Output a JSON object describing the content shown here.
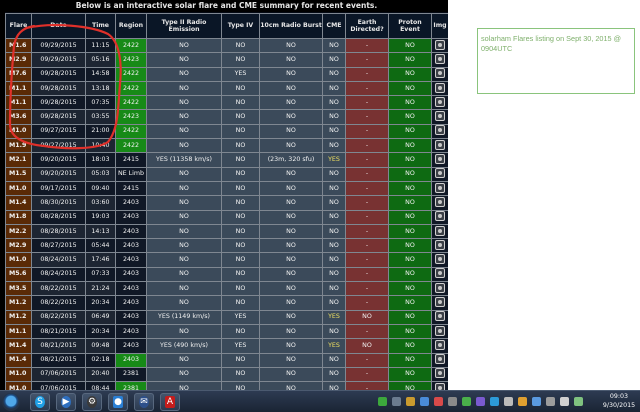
{
  "heading": "Below is an interactive solar flare and CME summary for recent events.",
  "table": {
    "headers": [
      "Flare",
      "Date",
      "Time",
      "Region",
      "Type II Radio Emission",
      "Type IV",
      "10cm Radio Burst",
      "CME",
      "Earth Directed?",
      "Proton Event",
      "Img"
    ],
    "rows": [
      {
        "flare": "M1.6",
        "date": "09/29/2015",
        "time": "11:15",
        "region": "2422",
        "t2": "NO",
        "t4": "NO",
        "radio": "NO",
        "cme": "NO",
        "earth": "-",
        "proton": "NO",
        "region_style": "green"
      },
      {
        "flare": "M2.9",
        "date": "09/29/2015",
        "time": "05:16",
        "region": "2423",
        "t2": "NO",
        "t4": "NO",
        "radio": "NO",
        "cme": "NO",
        "earth": "-",
        "proton": "NO",
        "region_style": "green"
      },
      {
        "flare": "M7.6",
        "date": "09/28/2015",
        "time": "14:58",
        "region": "2422",
        "t2": "NO",
        "t4": "YES",
        "radio": "NO",
        "cme": "NO",
        "earth": "-",
        "proton": "NO",
        "region_style": "green"
      },
      {
        "flare": "M1.1",
        "date": "09/28/2015",
        "time": "13:18",
        "region": "2422",
        "t2": "NO",
        "t4": "NO",
        "radio": "NO",
        "cme": "NO",
        "earth": "-",
        "proton": "NO",
        "region_style": "green"
      },
      {
        "flare": "M1.1",
        "date": "09/28/2015",
        "time": "07:35",
        "region": "2422",
        "t2": "NO",
        "t4": "NO",
        "radio": "NO",
        "cme": "NO",
        "earth": "-",
        "proton": "NO",
        "region_style": "green"
      },
      {
        "flare": "M3.6",
        "date": "09/28/2015",
        "time": "03:55",
        "region": "2423",
        "t2": "NO",
        "t4": "NO",
        "radio": "NO",
        "cme": "NO",
        "earth": "-",
        "proton": "NO",
        "region_style": "green"
      },
      {
        "flare": "M1.0",
        "date": "09/27/2015",
        "time": "21:00",
        "region": "2422",
        "t2": "NO",
        "t4": "NO",
        "radio": "NO",
        "cme": "NO",
        "earth": "-",
        "proton": "NO",
        "region_style": "green"
      },
      {
        "flare": "M1.9",
        "date": "09/27/2015",
        "time": "10:40",
        "region": "2422",
        "t2": "NO",
        "t4": "NO",
        "radio": "NO",
        "cme": "NO",
        "earth": "-",
        "proton": "NO",
        "region_style": "green"
      },
      {
        "flare": "M2.1",
        "date": "09/20/2015",
        "time": "18:03",
        "region": "2415",
        "t2": "YES (11358 km/s)",
        "t4": "NO",
        "radio": "(23m, 320 sfu)",
        "cme": "YES",
        "earth": "-",
        "proton": "NO",
        "region_style": "dark"
      },
      {
        "flare": "M1.5",
        "date": "09/20/2015",
        "time": "05:03",
        "region": "NE Limb",
        "t2": "NO",
        "t4": "NO",
        "radio": "NO",
        "cme": "NO",
        "earth": "-",
        "proton": "NO",
        "region_style": "dark"
      },
      {
        "flare": "M1.0",
        "date": "09/17/2015",
        "time": "09:40",
        "region": "2415",
        "t2": "NO",
        "t4": "NO",
        "radio": "NO",
        "cme": "NO",
        "earth": "-",
        "proton": "NO",
        "region_style": "dark"
      },
      {
        "flare": "M1.4",
        "date": "08/30/2015",
        "time": "03:60",
        "region": "2403",
        "t2": "NO",
        "t4": "NO",
        "radio": "NO",
        "cme": "NO",
        "earth": "-",
        "proton": "NO",
        "region_style": "dark"
      },
      {
        "flare": "M1.8",
        "date": "08/28/2015",
        "time": "19:03",
        "region": "2403",
        "t2": "NO",
        "t4": "NO",
        "radio": "NO",
        "cme": "NO",
        "earth": "-",
        "proton": "NO",
        "region_style": "dark"
      },
      {
        "flare": "M2.2",
        "date": "08/28/2015",
        "time": "14:13",
        "region": "2403",
        "t2": "NO",
        "t4": "NO",
        "radio": "NO",
        "cme": "NO",
        "earth": "-",
        "proton": "NO",
        "region_style": "dark"
      },
      {
        "flare": "M2.9",
        "date": "08/27/2015",
        "time": "05:44",
        "region": "2403",
        "t2": "NO",
        "t4": "NO",
        "radio": "NO",
        "cme": "NO",
        "earth": "-",
        "proton": "NO",
        "region_style": "dark"
      },
      {
        "flare": "M1.0",
        "date": "08/24/2015",
        "time": "17:46",
        "region": "2403",
        "t2": "NO",
        "t4": "NO",
        "radio": "NO",
        "cme": "NO",
        "earth": "-",
        "proton": "NO",
        "region_style": "dark"
      },
      {
        "flare": "M5.6",
        "date": "08/24/2015",
        "time": "07:33",
        "region": "2403",
        "t2": "NO",
        "t4": "NO",
        "radio": "NO",
        "cme": "NO",
        "earth": "-",
        "proton": "NO",
        "region_style": "dark"
      },
      {
        "flare": "M3.5",
        "date": "08/22/2015",
        "time": "21:24",
        "region": "2403",
        "t2": "NO",
        "t4": "NO",
        "radio": "NO",
        "cme": "NO",
        "earth": "-",
        "proton": "NO",
        "region_style": "dark"
      },
      {
        "flare": "M1.2",
        "date": "08/22/2015",
        "time": "20:34",
        "region": "2403",
        "t2": "NO",
        "t4": "NO",
        "radio": "NO",
        "cme": "NO",
        "earth": "-",
        "proton": "NO",
        "region_style": "dark"
      },
      {
        "flare": "M1.2",
        "date": "08/22/2015",
        "time": "06:49",
        "region": "2403",
        "t2": "YES (1149 km/s)",
        "t4": "YES",
        "radio": "NO",
        "cme": "YES",
        "earth": "NO",
        "proton": "NO",
        "region_style": "dark"
      },
      {
        "flare": "M1.1",
        "date": "08/21/2015",
        "time": "20:34",
        "region": "2403",
        "t2": "NO",
        "t4": "NO",
        "radio": "NO",
        "cme": "NO",
        "earth": "-",
        "proton": "NO",
        "region_style": "dark"
      },
      {
        "flare": "M1.4",
        "date": "08/21/2015",
        "time": "09:48",
        "region": "2403",
        "t2": "YES (490 km/s)",
        "t4": "YES",
        "radio": "NO",
        "cme": "YES",
        "earth": "NO",
        "proton": "NO",
        "region_style": "dark"
      },
      {
        "flare": "M1.4",
        "date": "08/21/2015",
        "time": "02:18",
        "region": "2403",
        "t2": "NO",
        "t4": "NO",
        "radio": "NO",
        "cme": "NO",
        "earth": "-",
        "proton": "NO",
        "region_style": "green"
      },
      {
        "flare": "M1.0",
        "date": "07/06/2015",
        "time": "20:40",
        "region": "2381",
        "t2": "NO",
        "t4": "NO",
        "radio": "NO",
        "cme": "NO",
        "earth": "-",
        "proton": "NO",
        "region_style": "dark"
      },
      {
        "flare": "M1.0",
        "date": "07/06/2015",
        "time": "08:44",
        "region": "2381",
        "t2": "NO",
        "t4": "NO",
        "radio": "NO",
        "cme": "NO",
        "earth": "-",
        "proton": "NO",
        "region_style": "green"
      }
    ]
  },
  "note": "solarham Flares listing on Sept 30, 2015 @ 0904UTC",
  "taskbar": {
    "apps": [
      "skype",
      "media-player",
      "settings",
      "videocam",
      "thunderbird",
      "acrobat"
    ],
    "clock_time": "09:03",
    "clock_date": "9/30/2015"
  },
  "colors": {
    "flare_cell": "#5a2a06",
    "region_green": "#178a17",
    "cme_yes": "#f0e060",
    "earth_cell": "#783232",
    "proton_cell": "#0e6a12",
    "annotation": "#e0302a",
    "note_text": "#7fb06c"
  }
}
